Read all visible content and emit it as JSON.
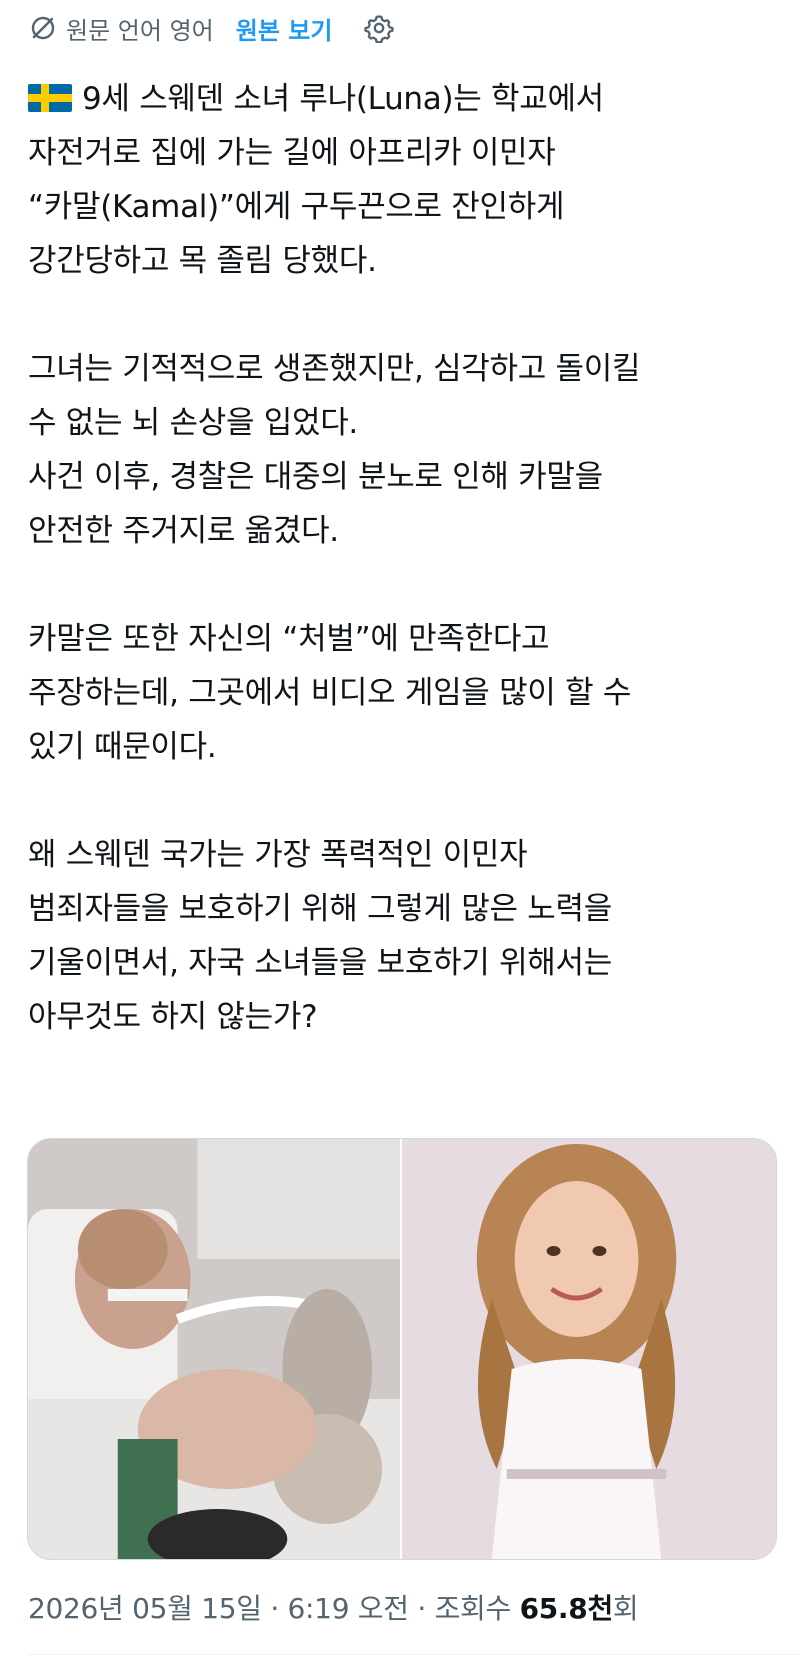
{
  "translation_bar": {
    "label": "원문 언어 영어",
    "show_original": "원본 보기",
    "icons": {
      "translate": "translate-icon",
      "settings": "gear-icon"
    }
  },
  "tweet": {
    "flag_icon": "sweden-flag-icon",
    "paragraphs": [
      [
        "9세 스웨덴 소녀 루나(Luna)는 학교에서",
        "자전거로 집에 가는 길에 아프리카 이민자",
        "“카말(Kamal)”에게 구두끈으로 잔인하게",
        "강간당하고 목 졸림 당했다."
      ],
      [
        "그녀는 기적적으로 생존했지만, 심각하고 돌이킬",
        "수 없는 뇌 손상을 입었다.",
        "사건 이후, 경찰은 대중의 분노로 인해 카말을",
        "안전한 주거지로 옮겼다."
      ],
      [
        "카말은 또한 자신의 “처벌”에 만족한다고",
        "주장하는데, 그곳에서 비디오 게임을 많이 할 수",
        "있기 때문이다."
      ],
      [
        "왜 스웨덴 국가는 가장 폭력적인 이민자",
        "범죄자들을 보호하기 위해 그렇게 많은 노력을",
        "기울이면서, 자국 소녀들을 보호하기 위해서는",
        "아무것도 하지 않는가?"
      ]
    ]
  },
  "media": {
    "photos": [
      "hospital-bed-photo",
      "portrait-photo"
    ]
  },
  "meta": {
    "date": "2026년 05월 15일",
    "separator": "·",
    "time": "6:19 오전",
    "views_label": "조회수",
    "views_count": "65.8천",
    "views_suffix": "회"
  },
  "colors": {
    "accent": "#1d9bf0",
    "secondary_text": "#536471",
    "primary_text": "#0f1419"
  }
}
